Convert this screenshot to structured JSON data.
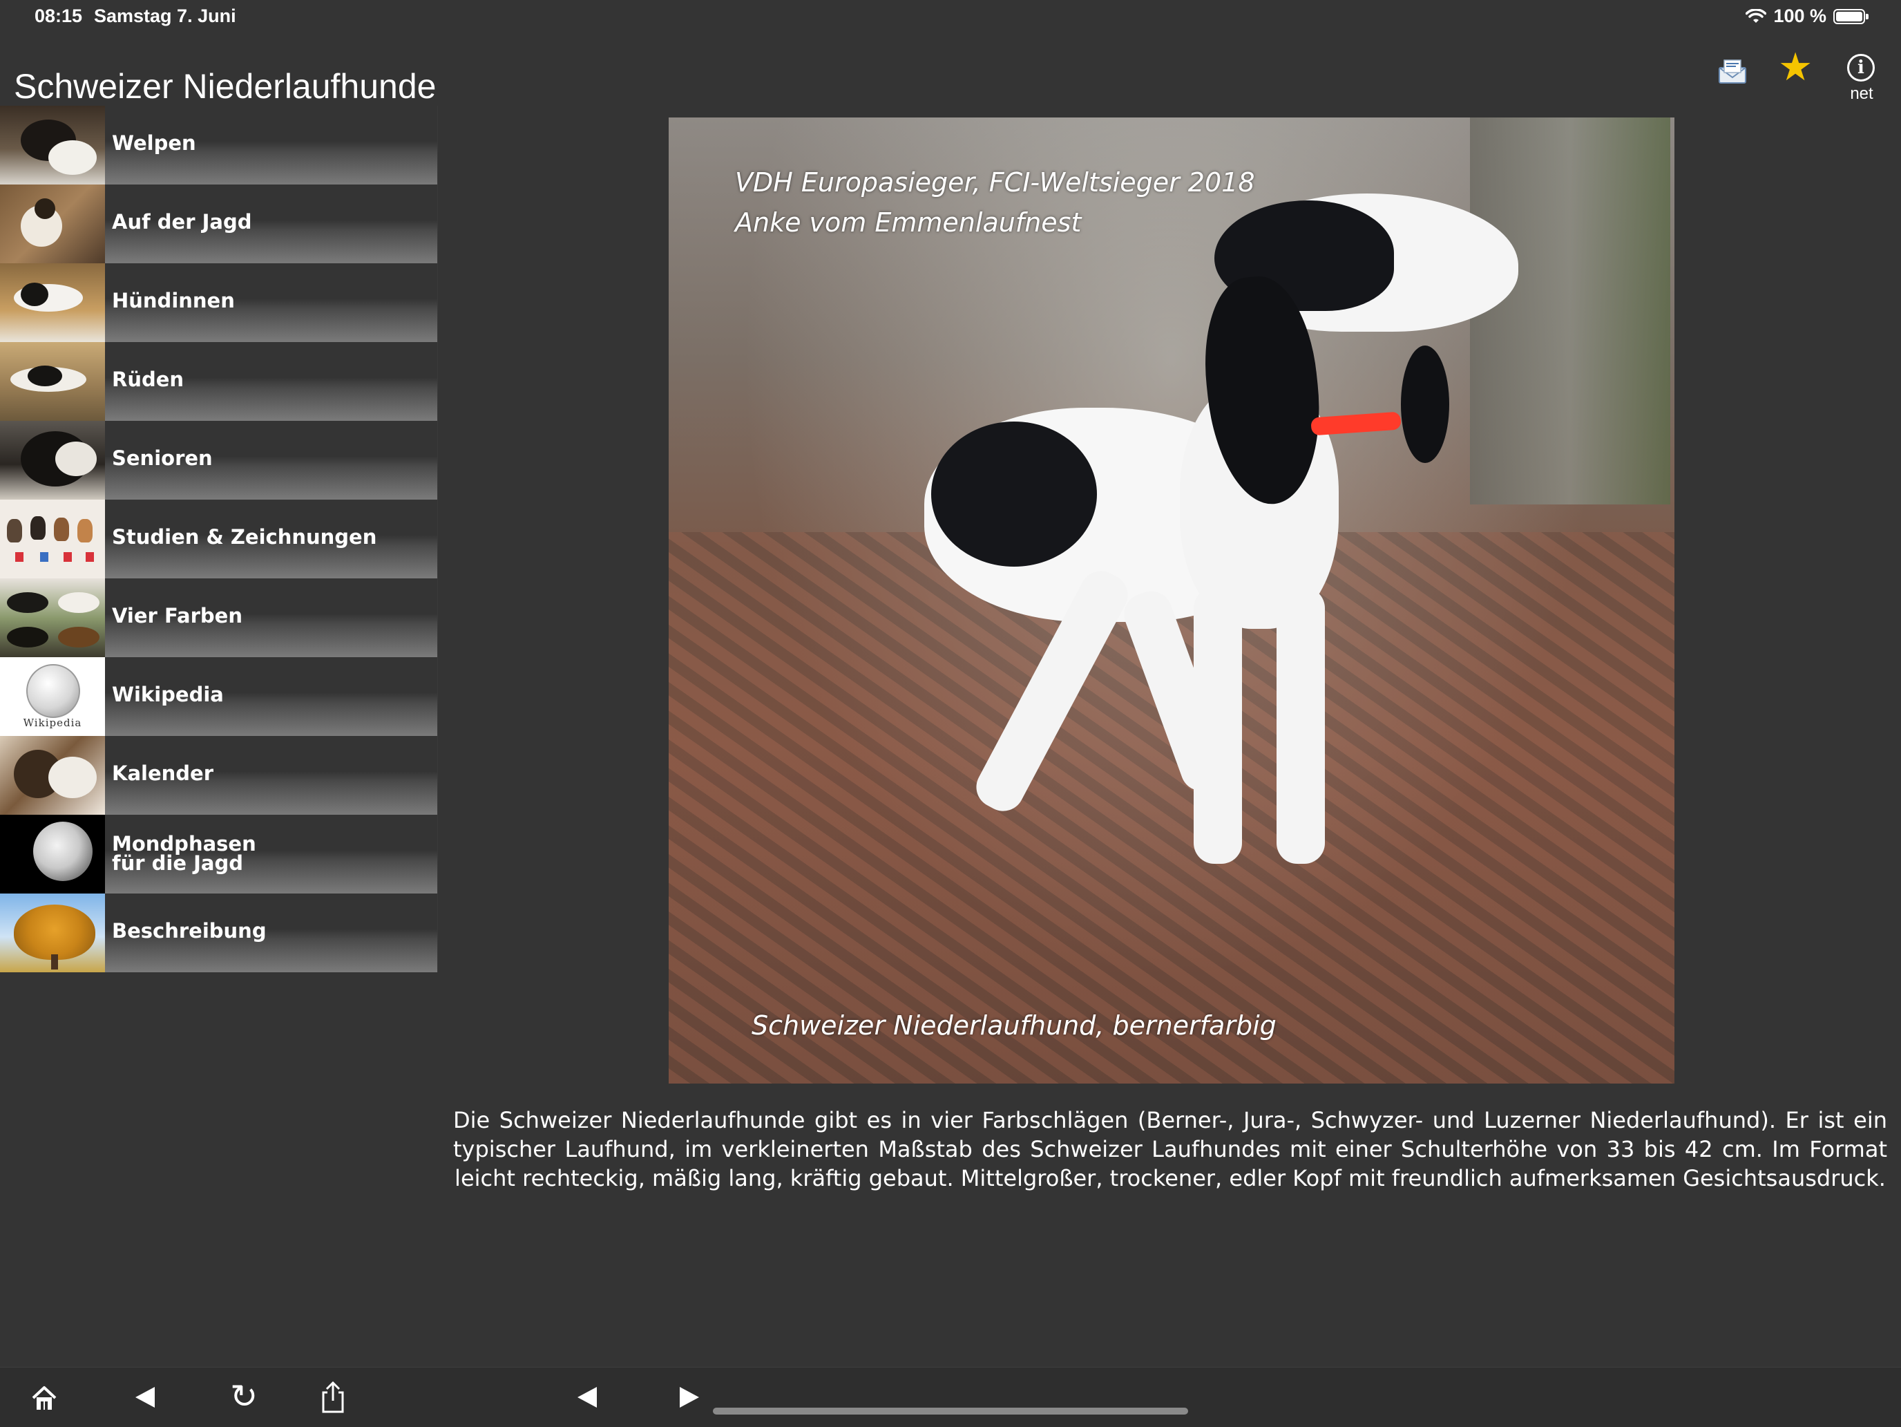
{
  "status_bar": {
    "time": "08:15",
    "date": "Samstag 7. Juni",
    "battery": "100 %",
    "wifi_icon": "wifi-icon",
    "battery_icon": "battery-icon"
  },
  "header": {
    "title": "Schweizer Niederlaufhunde",
    "buttons": [
      {
        "icon": "mail-icon"
      },
      {
        "icon": "star-icon",
        "color": "#f5c400"
      },
      {
        "icon": "info-icon",
        "label": "net"
      }
    ]
  },
  "sidebar": {
    "items": [
      {
        "label": "Welpen"
      },
      {
        "label": "Auf der Jagd"
      },
      {
        "label": "Hündinnen"
      },
      {
        "label": "Rüden"
      },
      {
        "label": "Senioren"
      },
      {
        "label": "Studien & Zeichnungen"
      },
      {
        "label": "Vier Farben"
      },
      {
        "label": "Wikipedia",
        "thumb_text": "Wikipedia"
      },
      {
        "label": "Kalender"
      },
      {
        "label_line1": "Mondphasen",
        "label_line2": "für die Jagd"
      },
      {
        "label": "Beschreibung"
      }
    ]
  },
  "main": {
    "photo_caption_top_1": "VDH Europasieger, FCI-Weltsieger 2018",
    "photo_caption_top_2": "Anke vom Emmenlaufnest",
    "photo_caption_bottom": "Schweizer Niederlaufhund, bernerfarbig",
    "description": "Die Schweizer Niederlaufhunde gibt es in vier Farbschlägen (Berner-, Jura-, Schwyzer- und Luzerner Niederlaufhund). Er ist ein typischer Laufhund, im verkleinerten Maßstab des Schweizer Laufhundes mit einer Schulterhöhe von 33 bis 42 cm. Im Format leicht rechteckig, mäßig lang, kräftig gebaut. Mittelgroßer, trockener, edler Kopf mit freundlich aufmerksamen Gesichtsausdruck."
  },
  "toolbar": {
    "buttons": [
      "home-icon",
      "back-icon",
      "refresh-icon",
      "share-icon",
      "prev-icon",
      "next-icon"
    ]
  }
}
